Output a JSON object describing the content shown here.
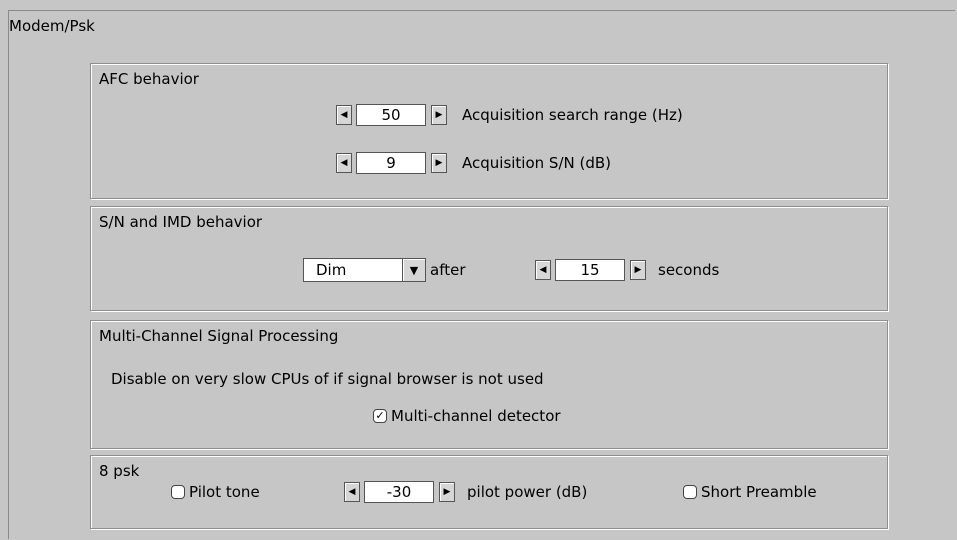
{
  "panel_title": "Modem/Psk",
  "afc": {
    "title": "AFC behavior",
    "search_range": {
      "value": "50",
      "label": "Acquisition search range (Hz)"
    },
    "sn": {
      "value": "9",
      "label": "Acquisition S/N (dB)"
    }
  },
  "snimd": {
    "title": "S/N and IMD behavior",
    "mode": "Dim",
    "after_label": "after",
    "seconds_value": "15",
    "seconds_label": "seconds"
  },
  "multichannel": {
    "title": "Multi-Channel Signal Processing",
    "note": "Disable on very slow CPUs of if signal browser is not used",
    "detector_label": "Multi-channel detector",
    "detector_checked": true
  },
  "psk8": {
    "title": "8 psk",
    "pilot_tone_label": "Pilot tone",
    "pilot_tone_checked": false,
    "pilot_power_value": "-30",
    "pilot_power_label": "pilot power (dB)",
    "short_preamble_label": "Short Preamble",
    "short_preamble_checked": false
  },
  "icons": {
    "decrement": "left-arrow-icon",
    "increment": "right-arrow-icon",
    "dropdown": "chevron-down-icon",
    "check": "check-icon"
  }
}
